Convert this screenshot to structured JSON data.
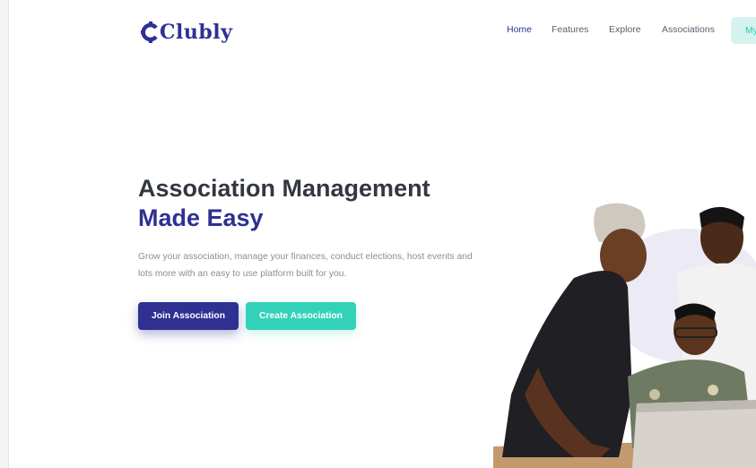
{
  "brand": {
    "name": "Clubly",
    "color": "#2e3192"
  },
  "nav": {
    "items": [
      {
        "label": "Home",
        "active": true
      },
      {
        "label": "Features",
        "active": false
      },
      {
        "label": "Explore",
        "active": false
      },
      {
        "label": "Associations",
        "active": false
      }
    ],
    "cta_label": "My"
  },
  "hero": {
    "title_line1": "Association Management",
    "title_line2": "Made Easy",
    "subtitle": "Grow your association, manage your finances, conduct elections, host events and lots more with an easy to use platform built for you.",
    "join_label": "Join Association",
    "create_label": "Create Association"
  },
  "colors": {
    "primary": "#2e3192",
    "accent": "#33d1b8",
    "accent_light": "#d4f3ee",
    "heading": "#333740"
  },
  "icons": {
    "logo": "clubly-logo-icon"
  }
}
